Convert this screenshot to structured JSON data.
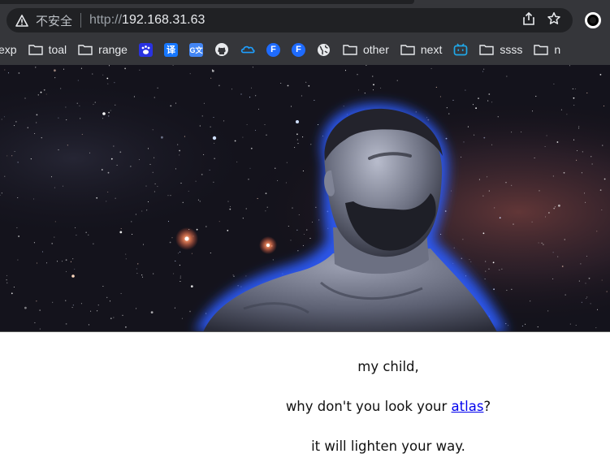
{
  "browser": {
    "security_label": "不安全",
    "url_scheme": "http://",
    "url_host": "192.168.31.63"
  },
  "bookmarks": [
    {
      "label": "exp",
      "icon": "folder-icon"
    },
    {
      "label": "toal",
      "icon": "folder-icon"
    },
    {
      "label": "range",
      "icon": "folder-icon"
    },
    {
      "label": "",
      "icon": "baidu-icon"
    },
    {
      "label": "",
      "icon": "translate-icon"
    },
    {
      "label": "",
      "icon": "google-translate-icon"
    },
    {
      "label": "",
      "icon": "github-icon"
    },
    {
      "label": "",
      "icon": "cloud-icon"
    },
    {
      "label": "",
      "icon": "f-blue-icon"
    },
    {
      "label": "",
      "icon": "f-blue-icon"
    },
    {
      "label": "",
      "icon": "globe-icon"
    },
    {
      "label": "other",
      "icon": "folder-icon"
    },
    {
      "label": "next",
      "icon": "folder-icon"
    },
    {
      "label": "",
      "icon": "bilibili-icon"
    },
    {
      "label": "ssss",
      "icon": "folder-icon"
    },
    {
      "label": "n",
      "icon": "folder-icon"
    }
  ],
  "page": {
    "line1": "my child,",
    "line2_prefix": "why don't you look your ",
    "link_text": "atlas",
    "line2_suffix": "?",
    "line3": "it will lighten your way."
  },
  "colors": {
    "chrome": "#35363a",
    "link": "#0000ee",
    "glow": "#2f5cff"
  }
}
